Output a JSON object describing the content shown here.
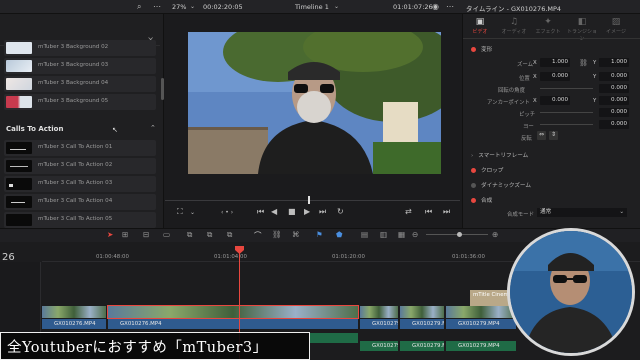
{
  "topbar": {
    "zoom": "27%",
    "source_timecode": "00:02:20:05",
    "timeline_name": "Timeline 1",
    "record_timecode": "01:01:07:26",
    "inspector_title": "タイムライン - GX010276.MP4"
  },
  "effects_list": {
    "backgrounds": [
      {
        "label": "mTuber 3 Background 02",
        "color": "#dfe6ee"
      },
      {
        "label": "mTuber 3 Background 03",
        "color": "#c9d6e4"
      },
      {
        "label": "mTuber 3 Background 04",
        "color": "#e4dcdc"
      },
      {
        "label": "mTuber 3 Background 05",
        "color": "#d54a5a"
      }
    ],
    "section_title": "Calls To Action",
    "calls": [
      {
        "label": "mTuber 3 Call To Action 01"
      },
      {
        "label": "mTuber 3 Call To Action 02"
      },
      {
        "label": "mTuber 3 Call To Action 03"
      },
      {
        "label": "mTuber 3 Call To Action 04"
      },
      {
        "label": "mTuber 3 Call To Action 05"
      }
    ]
  },
  "inspector": {
    "tabs": [
      {
        "label": "ビデオ",
        "icon": "video-icon"
      },
      {
        "label": "オーディオ",
        "icon": "audio-icon"
      },
      {
        "label": "エフェクト",
        "icon": "effects-icon"
      },
      {
        "label": "トランジション",
        "icon": "transition-icon"
      },
      {
        "label": "イメージ",
        "icon": "image-icon"
      }
    ],
    "transform_title": "変形",
    "zoom_label": "ズーム",
    "zoom_x": "1.000",
    "zoom_y": "1.000",
    "position_label": "位置",
    "position_x": "0.000",
    "position_y": "0.000",
    "rotation_label": "回転の角度",
    "rotation_value": "0.000",
    "anchor_label": "アンカーポイント",
    "anchor_x": "0.000",
    "anchor_y": "0.000",
    "pitch_label": "ピッチ",
    "pitch_value": "0.000",
    "yaw_label": "ヨー",
    "yaw_value": "0.000",
    "flip_label": "反転",
    "smart_reframe": "スマートリフレーム",
    "crop": "クロップ",
    "dynamic_zoom": "ダイナミックズーム",
    "composite": "合成",
    "composite_mode_label": "合成モード",
    "composite_mode_value": "通常",
    "x_label": "X",
    "y_label": "Y"
  },
  "timeline": {
    "track_number": "26",
    "timecodes": [
      "01:00:48:00",
      "01:01:04:00",
      "01:01:20:00",
      "01:01:36:00"
    ],
    "clips": [
      {
        "name": "GX010276.MP4"
      },
      {
        "name": "GX010276.MP4"
      },
      {
        "name": "GX010279.MP4"
      },
      {
        "name": "GX010279.MP4"
      },
      {
        "name": "GX010279.MP4"
      }
    ],
    "audio_clips": [
      {
        "name": "GX010276.MP4"
      },
      {
        "name": "GX010279.MP4"
      },
      {
        "name": "GX010279.MP4"
      },
      {
        "name": "GX010279.MP4"
      }
    ],
    "title_clip": "mTitle Cinema"
  },
  "caption": "全Youtuberにおすすめ「mTuber3」",
  "colors": {
    "accent_red": "#e8473f",
    "audio_green": "#1f6b46",
    "clip_blue": "#2f5b8f"
  }
}
